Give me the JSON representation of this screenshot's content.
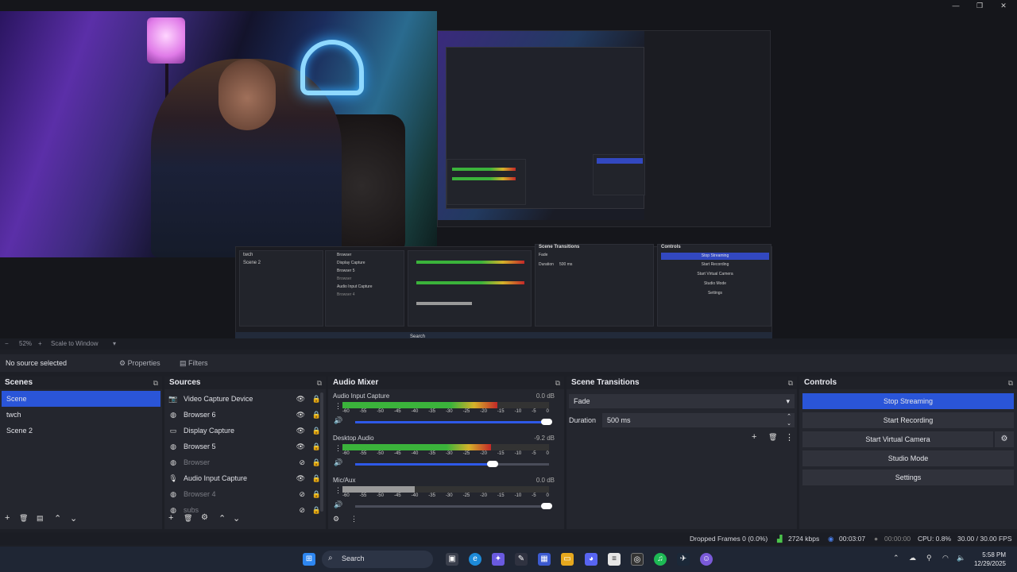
{
  "window": {
    "minimize": "—",
    "maximize": "❐",
    "close": "✕"
  },
  "preview": {
    "nested": {
      "scene_transitions": "Scene Transitions",
      "controls": "Controls",
      "fade": "Fade",
      "duration": "Duration",
      "duration_value": "500 ms",
      "stop_streaming": "Stop Streaming",
      "start_recording": "Start Recording",
      "start_virtual_camera": "Start Virtual Camera",
      "studio_mode": "Studio Mode",
      "settings": "Settings",
      "scenes": [
        "twch",
        "Scene 2"
      ],
      "sources": [
        "Browser",
        "Display Capture",
        "Browser 5",
        "Browser",
        "Audio Input Capture",
        "Browser 4"
      ],
      "search": "Search"
    }
  },
  "zoom": {
    "level": "52%",
    "mode": "Scale to Window"
  },
  "source_toolbar": {
    "no_source": "No source selected",
    "properties": "Properties",
    "filters": "Filters"
  },
  "scenes": {
    "title": "Scenes",
    "items": [
      "Scene",
      "twch",
      "Scene 2"
    ],
    "selected": 0
  },
  "sources": {
    "title": "Sources",
    "items": [
      {
        "label": "Video Capture Device",
        "icon": "camera-icon",
        "visible": true
      },
      {
        "label": "Browser 6",
        "icon": "globe-icon",
        "visible": true
      },
      {
        "label": "Display Capture",
        "icon": "monitor-icon",
        "visible": true
      },
      {
        "label": "Browser 5",
        "icon": "globe-icon",
        "visible": true
      },
      {
        "label": "Browser",
        "icon": "globe-icon",
        "visible": false
      },
      {
        "label": "Audio Input Capture",
        "icon": "mic-icon",
        "visible": true
      },
      {
        "label": "Browser 4",
        "icon": "globe-icon",
        "visible": false
      },
      {
        "label": "subs",
        "icon": "globe-icon",
        "visible": false
      }
    ]
  },
  "audio_mixer": {
    "title": "Audio Mixer",
    "scale": [
      "-60",
      "-55",
      "-50",
      "-45",
      "-40",
      "-35",
      "-30",
      "-25",
      "-20",
      "-15",
      "-10",
      "-5",
      "0"
    ],
    "channels": [
      {
        "name": "Audio Input Capture",
        "db": "0.0 dB",
        "level": 0.75,
        "volume": 1.0,
        "muted": false
      },
      {
        "name": "Desktop Audio",
        "db": "-9.2 dB",
        "level": 0.72,
        "volume": 0.72,
        "muted": false
      },
      {
        "name": "Mic/Aux",
        "db": "0.0 dB",
        "level": 0.35,
        "volume": 1.0,
        "muted": true
      }
    ]
  },
  "scene_transitions": {
    "title": "Scene Transitions",
    "transition": "Fade",
    "duration_label": "Duration",
    "duration_value": "500 ms"
  },
  "controls": {
    "title": "Controls",
    "stop_streaming": "Stop Streaming",
    "start_recording": "Start Recording",
    "start_virtual_camera": "Start Virtual Camera",
    "studio_mode": "Studio Mode",
    "settings": "Settings"
  },
  "status": {
    "dropped": "Dropped Frames 0 (0.0%)",
    "bitrate": "2724 kbps",
    "stream_time": "00:03:07",
    "rec_time": "00:00:00",
    "cpu": "CPU: 0.8%",
    "fps": "30.00 / 30.00 FPS"
  },
  "taskbar": {
    "search": "Search",
    "time": "5:58 PM",
    "date": "12/29/2025"
  },
  "colors": {
    "accent": "#2a55d8",
    "panel": "#24262e",
    "bg": "#1d1f26",
    "meter_green": "#3bb33b",
    "meter_yellow": "#d4b22a",
    "meter_red": "#c42828"
  }
}
